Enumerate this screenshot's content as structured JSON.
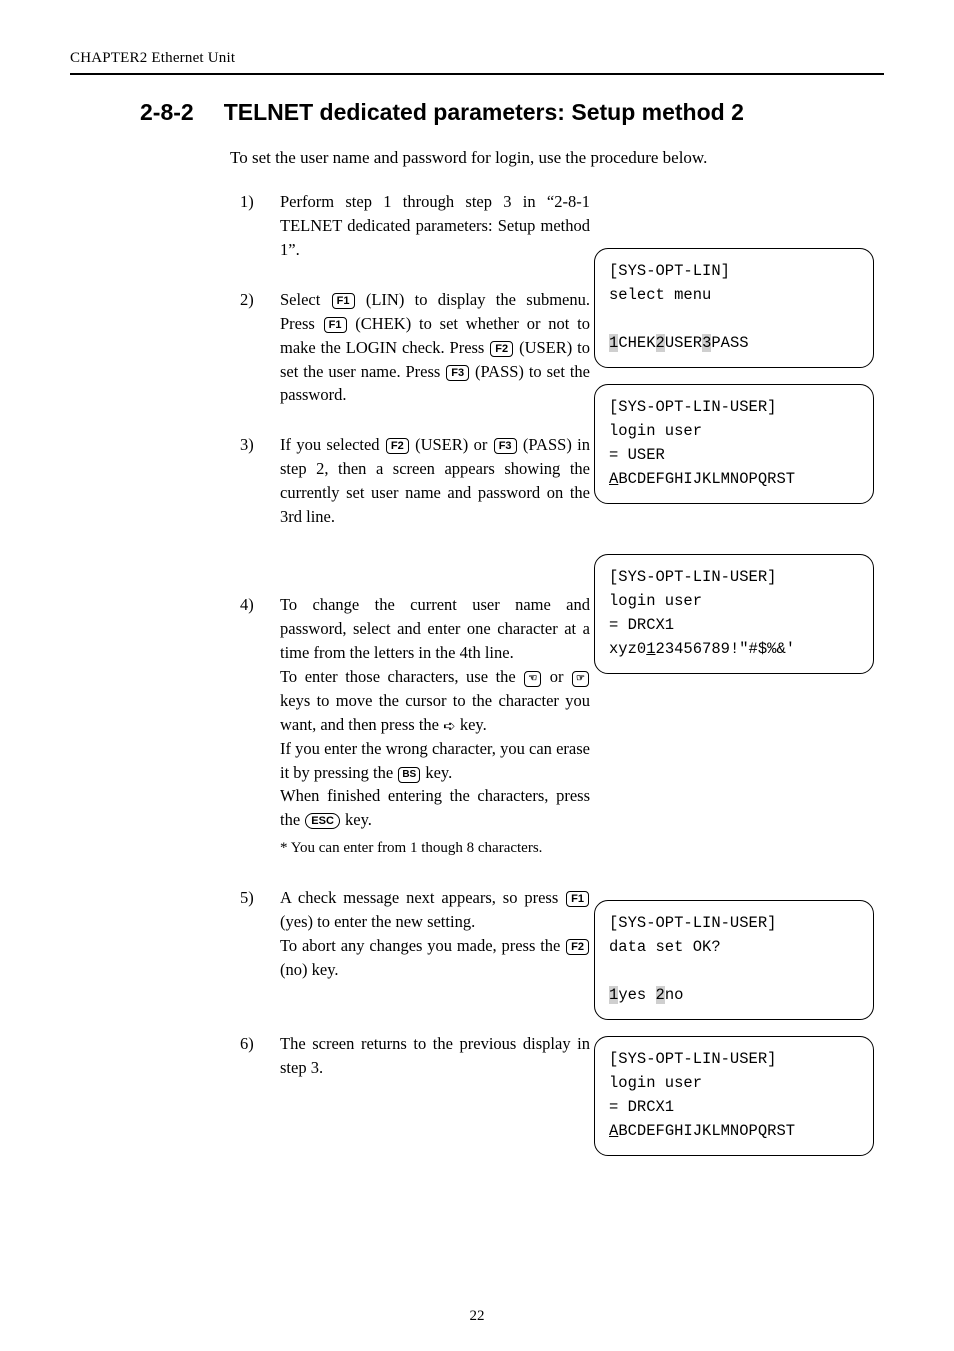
{
  "running_head": "CHAPTER2  Ethernet Unit",
  "section": {
    "number": "2-8-2",
    "title": "TELNET dedicated parameters: Setup method 2"
  },
  "intro": "To set the user name and password for login, use the procedure below.",
  "steps": [
    {
      "num": "1)",
      "pre1": "Perform step 1 through step 3 in “2-8-1 TELNET dedicated parameters: Setup method 1”."
    },
    {
      "num": "2)",
      "s1a": "Select ",
      "k1": "F1",
      "s1b": " (LIN) to display the submenu. Press ",
      "k2": "F1",
      "s1c": " (CHEK) to set whether or not to make the LOGIN check. Press ",
      "k3": "F2",
      "s1d": " (USER) to set the user name. Press ",
      "k4": "F3",
      "s1e": " (PASS) to set the password."
    },
    {
      "num": "3)",
      "s1a": "If you selected ",
      "k1": "F2",
      "s1b": " (USER) or ",
      "k2": "F3",
      "s1c": " (PASS) in step 2, then a screen appears showing the currently set user name and password on the 3rd line."
    },
    {
      "num": "4)",
      "p1": "To change the current user name and password, select and enter one character at a time from the letters in the 4th line.",
      "p2a": "To enter those characters, use the ",
      "p2b": " or ",
      "p2c": " keys to move the cursor to the character you want, and then press the ",
      "p2d": " key.",
      "p3a": "If you enter the wrong character, you can erase it by pressing the ",
      "kbs": "BS",
      "p3b": " key.",
      "p4a": "When finished entering the characters, press the ",
      "kesc": "ESC",
      "p4b": " key.",
      "note": "* You can enter from 1 though 8 characters."
    },
    {
      "num": "5)",
      "s1a": "A check message next appears, so press ",
      "k1": "F1",
      "s1b": " (yes) to enter the new setting.",
      "s2a": "To abort any changes you made, press the ",
      "k2": "F2",
      "s2b": " (no) key."
    },
    {
      "num": "6)",
      "text": "The screen returns to the previous display in step 3."
    }
  ],
  "screens": {
    "s1": {
      "l1": "[SYS-OPT-LIN]",
      "l2": "select menu",
      "l4a": "1",
      "l4b": "CHEK",
      "l4c": "2",
      "l4d": "USER",
      "l4e": "3",
      "l4f": "PASS"
    },
    "s2": {
      "l1": "[SYS-OPT-LIN-USER]",
      "l2": "login user",
      "l3": "= USER",
      "l4a": "A",
      "l4b": "BCDEFGHIJKLMNOPQRST"
    },
    "s3": {
      "l1": "[SYS-OPT-LIN-USER]",
      "l2": "login user",
      "l3": "= DRCX1",
      "l4a": "xyz0",
      "l4b": "1",
      "l4c": "23456789!\"#$%&'"
    },
    "s4": {
      "l1": "[SYS-OPT-LIN-USER]",
      "l2": "data set OK?",
      "l4a": "1",
      "l4b": "yes ",
      "l4c": "2",
      "l4d": "no"
    },
    "s5": {
      "l1": "[SYS-OPT-LIN-USER]",
      "l2": "login user",
      "l3": "= DRCX1",
      "l4a": "A",
      "l4b": "BCDEFGHIJKLMNOPQRST"
    }
  },
  "page_number": "22"
}
